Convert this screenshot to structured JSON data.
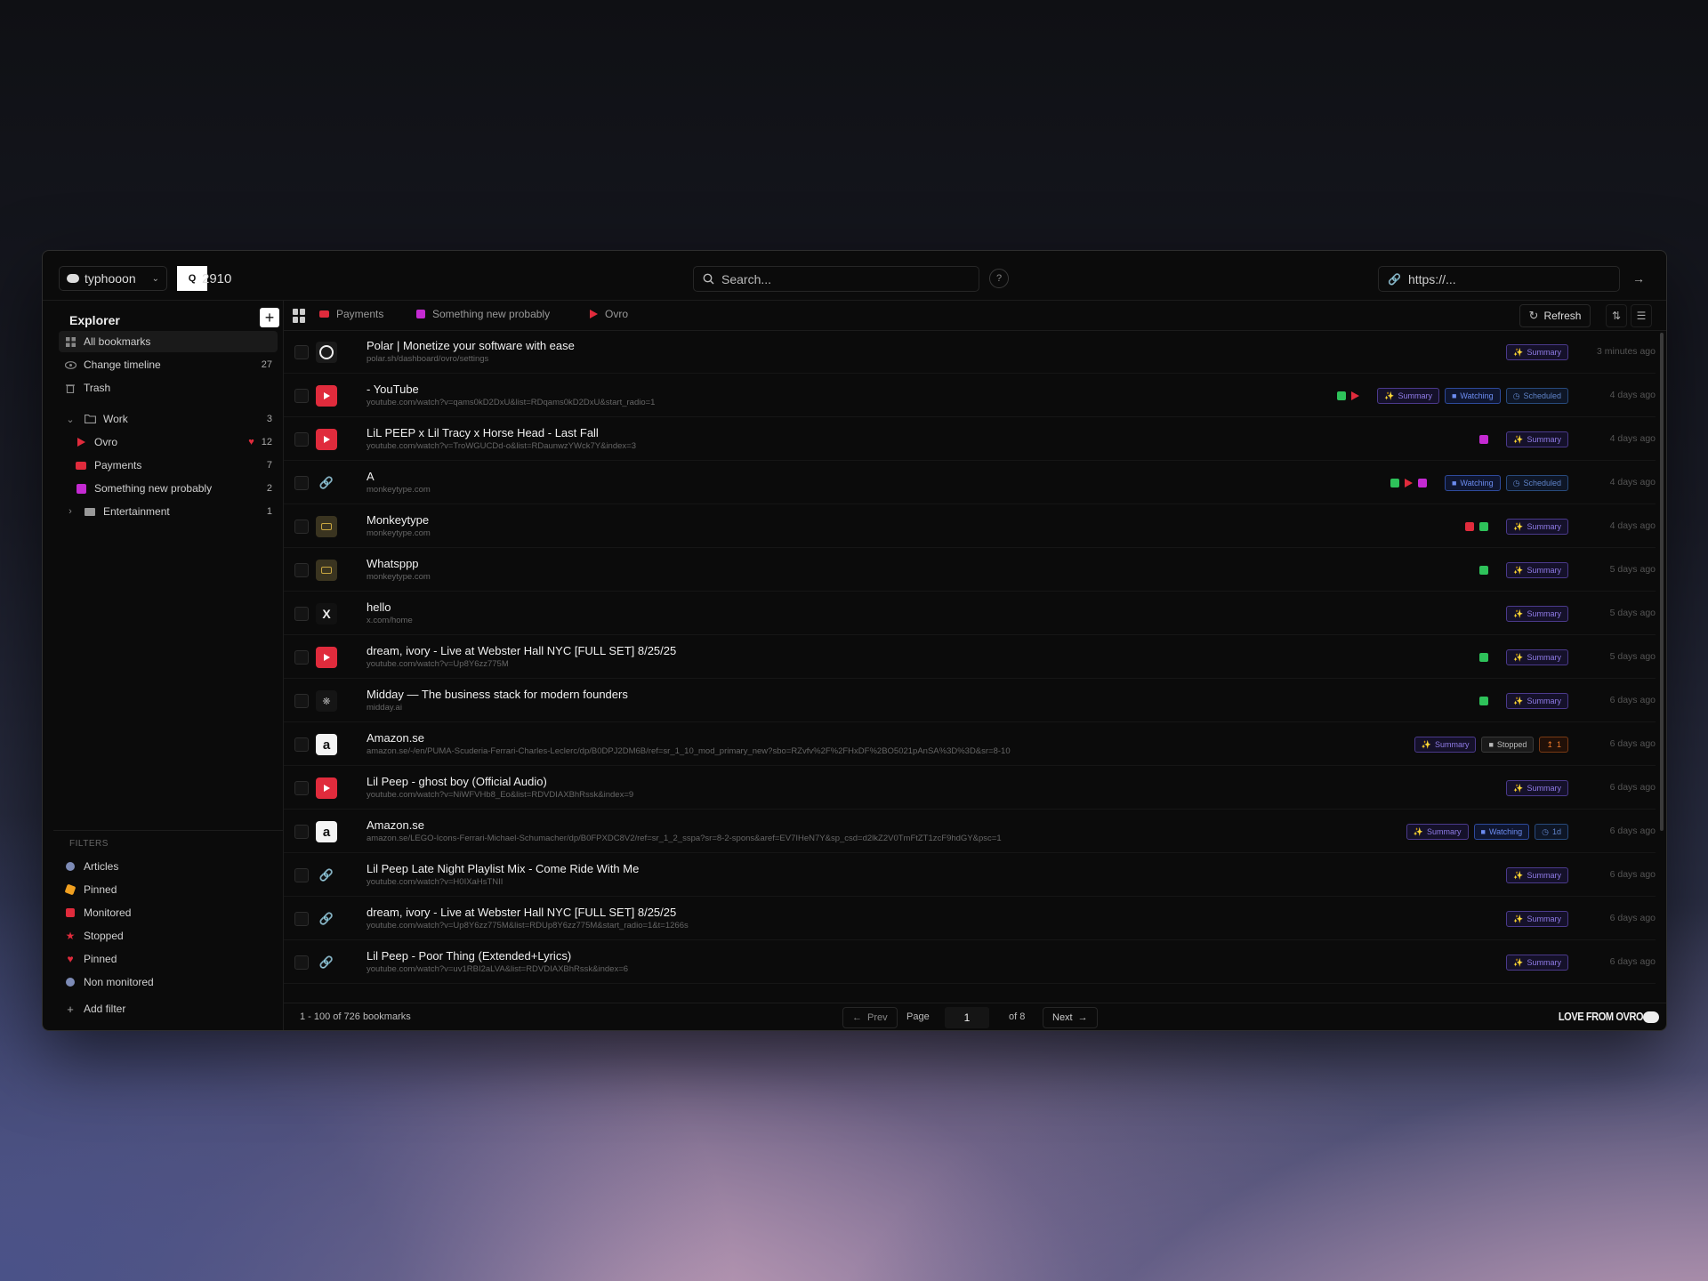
{
  "topbar": {
    "workspace": "typhooon",
    "q_label": "Q",
    "q_number": "2910",
    "search_placeholder": "Search...",
    "help_label": "?",
    "url_placeholder": "https://..."
  },
  "sidebar": {
    "title": "Explorer",
    "items": [
      {
        "label": "All bookmarks",
        "count": "",
        "icon": "grid-icon"
      },
      {
        "label": "Change timeline",
        "count": "27",
        "icon": "eye-icon"
      },
      {
        "label": "Trash",
        "count": "",
        "icon": "trash-icon"
      }
    ],
    "folders": [
      {
        "label": "Work",
        "count": "3",
        "expanded": true
      },
      {
        "label": "Ovro",
        "count": "12",
        "child": true,
        "icon": "youtube-red-icon",
        "color": "#e02b3c"
      },
      {
        "label": "Payments",
        "count": "7",
        "child": true,
        "icon": "card-red-icon",
        "color": "#e02b3c"
      },
      {
        "label": "Something new probably",
        "count": "2",
        "child": true,
        "icon": "pink-square-icon",
        "color": "#c42ad2"
      },
      {
        "label": "Entertainment",
        "count": "1",
        "expanded": false
      }
    ],
    "filters_label": "FILTERS",
    "filters": [
      {
        "label": "Articles",
        "color": "#7d8bb6"
      },
      {
        "label": "Pinned",
        "color": "#f0a020"
      },
      {
        "label": "Monitored",
        "color": "#e02b3c"
      },
      {
        "label": "Stopped",
        "color": "#e02b3c"
      },
      {
        "label": "Pinned",
        "color": "#e02b3c"
      },
      {
        "label": "Non monitored",
        "color": "#7d8bb6"
      }
    ],
    "add_filter": "Add filter"
  },
  "tabs": [
    {
      "label": "Payments",
      "color": "#e02b3c"
    },
    {
      "label": "Something new probably",
      "color": "#c42ad2"
    },
    {
      "label": "Ovro",
      "color": "#e02b3c"
    }
  ],
  "toolbar": {
    "refresh": "Refresh"
  },
  "bookmarks": [
    {
      "title": "Polar | Monetize your software with ease",
      "url": "polar.sh/dashboard/ovro/settings",
      "time": "3 minutes ago",
      "fav": "polar",
      "indicators": [],
      "badges": [
        {
          "t": "sum",
          "label": "Summary"
        }
      ]
    },
    {
      "title": "- YouTube",
      "url": "youtube.com/watch?v=qams0kD2DxU&list=RDqams0kD2DxU&start_radio=1",
      "time": "4 days ago",
      "fav": "yt",
      "indicators": [
        "green",
        "tri"
      ],
      "badges": [
        {
          "t": "sum",
          "label": "Summary"
        },
        {
          "t": "watch",
          "label": "Watching"
        },
        {
          "t": "sched",
          "label": "Scheduled"
        }
      ]
    },
    {
      "title": "LiL PEEP x Lil Tracy x Horse Head - Last Fall",
      "url": "youtube.com/watch?v=TroWGUCDd-o&list=RDaunwzYWck7Y&index=3",
      "time": "4 days ago",
      "fav": "yt",
      "indicators": [
        "pink"
      ],
      "badges": [
        {
          "t": "sum",
          "label": "Summary"
        }
      ]
    },
    {
      "title": "A",
      "url": "monkeytype.com",
      "time": "4 days ago",
      "fav": "link",
      "indicators": [
        "green",
        "tri",
        "pink"
      ],
      "badges": [
        {
          "t": "watch",
          "label": "Watching"
        },
        {
          "t": "sched",
          "label": "Scheduled"
        }
      ]
    },
    {
      "title": "Monkeytype",
      "url": "monkeytype.com",
      "time": "4 days ago",
      "fav": "mt",
      "indicators": [
        "red",
        "green"
      ],
      "badges": [
        {
          "t": "sum",
          "label": "Summary"
        }
      ]
    },
    {
      "title": "Whatsppp",
      "url": "monkeytype.com",
      "time": "5 days ago",
      "fav": "mt",
      "indicators": [
        "green"
      ],
      "badges": [
        {
          "t": "sum",
          "label": "Summary"
        }
      ]
    },
    {
      "title": "hello",
      "url": "x.com/home",
      "time": "5 days ago",
      "fav": "x",
      "indicators": [],
      "badges": [
        {
          "t": "sum",
          "label": "Summary"
        }
      ]
    },
    {
      "title": "dream, ivory - Live at Webster Hall NYC [FULL SET] 8/25/25",
      "url": "youtube.com/watch?v=Up8Y6zz775M",
      "time": "5 days ago",
      "fav": "yt",
      "indicators": [
        "green"
      ],
      "badges": [
        {
          "t": "sum",
          "label": "Summary"
        }
      ]
    },
    {
      "title": "Midday — The business stack for modern founders",
      "url": "midday.ai",
      "time": "6 days ago",
      "fav": "midday",
      "indicators": [
        "green"
      ],
      "badges": [
        {
          "t": "sum",
          "label": "Summary"
        }
      ]
    },
    {
      "title": "Amazon.se",
      "url": "amazon.se/-/en/PUMA-Scuderia-Ferrari-Charles-Leclerc/dp/B0DPJ2DM6B/ref=sr_1_10_mod_primary_new?sbo=RZvfv%2F%2FHxDF%2BO5021pAnSA%3D%3D&sr=8-10",
      "time": "6 days ago",
      "fav": "amz",
      "indicators": [],
      "badges": [
        {
          "t": "sum",
          "label": "Summary"
        },
        {
          "t": "stop",
          "label": "Stopped"
        },
        {
          "t": "warn",
          "label": "1"
        }
      ]
    },
    {
      "title": "Lil Peep - ghost boy (Official Audio)",
      "url": "youtube.com/watch?v=NiWFVHb8_Eo&list=RDVDIAXBhRssk&index=9",
      "time": "6 days ago",
      "fav": "yt",
      "indicators": [],
      "badges": [
        {
          "t": "sum",
          "label": "Summary"
        }
      ]
    },
    {
      "title": "Amazon.se",
      "url": "amazon.se/LEGO-Icons-Ferrari-Michael-Schumacher/dp/B0FPXDC8V2/ref=sr_1_2_sspa?sr=8-2-spons&aref=EV7IHeN7Y&sp_csd=d2lkZ2V0TmFtZT1zcF9hdGY&psc=1",
      "time": "6 days ago",
      "fav": "amz",
      "indicators": [],
      "badges": [
        {
          "t": "sum",
          "label": "Summary"
        },
        {
          "t": "watch",
          "label": "Watching"
        },
        {
          "t": "sched",
          "label": "1d"
        }
      ]
    },
    {
      "title": "Lil Peep Late Night Playlist Mix - Come Ride With Me",
      "url": "youtube.com/watch?v=H0IXaHsTNII",
      "time": "6 days ago",
      "fav": "link",
      "indicators": [],
      "badges": [
        {
          "t": "sum",
          "label": "Summary"
        }
      ]
    },
    {
      "title": "dream, ivory - Live at Webster Hall NYC [FULL SET] 8/25/25",
      "url": "youtube.com/watch?v=Up8Y6zz775M&list=RDUp8Y6zz775M&start_radio=1&t=1266s",
      "time": "6 days ago",
      "fav": "link",
      "indicators": [],
      "badges": [
        {
          "t": "sum",
          "label": "Summary"
        }
      ]
    },
    {
      "title": "Lil Peep - Poor Thing (Extended+Lyrics)",
      "url": "youtube.com/watch?v=uv1RBI2aLVA&list=RDVDIAXBhRssk&index=6",
      "time": "6 days ago",
      "fav": "link",
      "indicators": [],
      "badges": [
        {
          "t": "sum",
          "label": "Summary"
        }
      ]
    }
  ],
  "footer": {
    "count": "1 - 100 of 726 bookmarks",
    "prev": "Prev",
    "page_label": "Page",
    "page": "1",
    "of": "of 8",
    "next": "Next",
    "brand": "LOVE FROM OVRO"
  }
}
